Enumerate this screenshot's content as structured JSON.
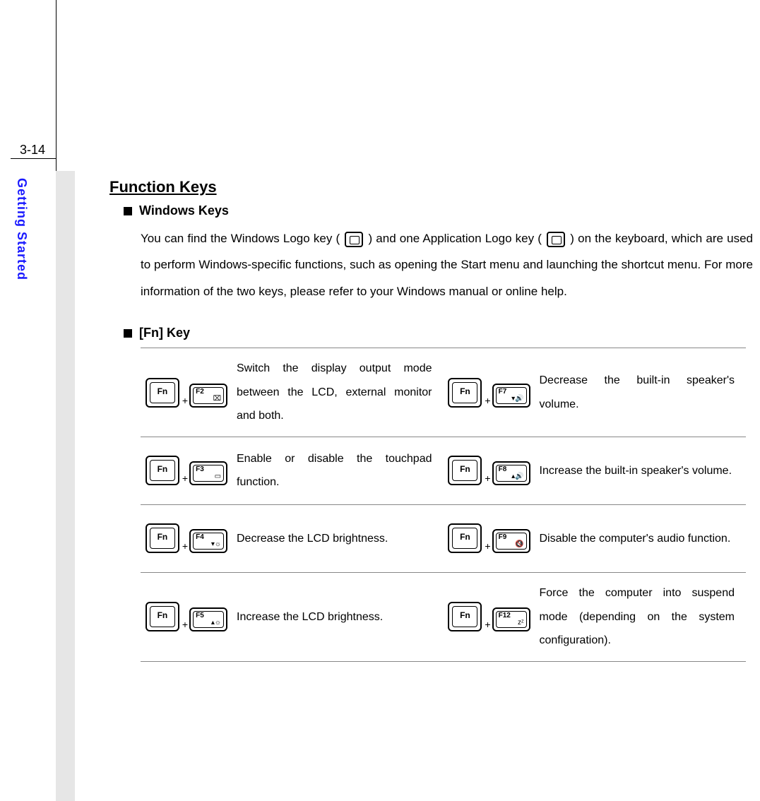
{
  "page_number": "3-14",
  "sidebar_label": "Getting Started",
  "title": "Function Keys",
  "sections": {
    "windows_keys": {
      "heading": "Windows Keys",
      "para_before_winkey": "You can find the Windows Logo key ( ",
      "para_mid": " ) and one Application Logo key ( ",
      "para_after": " ) on the keyboard, which are used to perform Windows-specific functions, such as opening the Start menu and launching the shortcut menu.  For more information of the two keys, please refer to your Windows manual or online help."
    },
    "fn_key": {
      "heading": "[Fn] Key",
      "fn_label": "Fn",
      "rows": [
        {
          "left_key": "F2",
          "left_icon": "⌧",
          "left_desc": "Switch the display output mode between the LCD, external monitor and both.",
          "right_key": "F7",
          "right_icon": "▾🔊",
          "right_desc": "Decrease the built-in speaker's volume."
        },
        {
          "left_key": "F3",
          "left_icon": "▭",
          "left_desc": "Enable or disable the touchpad function.",
          "right_key": "F8",
          "right_icon": "▴🔊",
          "right_desc": "Increase the built-in speaker's volume."
        },
        {
          "left_key": "F4",
          "left_icon": "▾☼",
          "left_desc": "Decrease the LCD brightness.",
          "right_key": "F9",
          "right_icon": "🔇",
          "right_desc": "Disable the computer's audio function."
        },
        {
          "left_key": "F5",
          "left_icon": "▴☼",
          "left_desc": "Increase the LCD brightness.",
          "right_key": "F12",
          "right_icon": "zᶻ",
          "right_desc": "Force the computer into suspend mode (depending on the system configuration)."
        }
      ]
    }
  }
}
